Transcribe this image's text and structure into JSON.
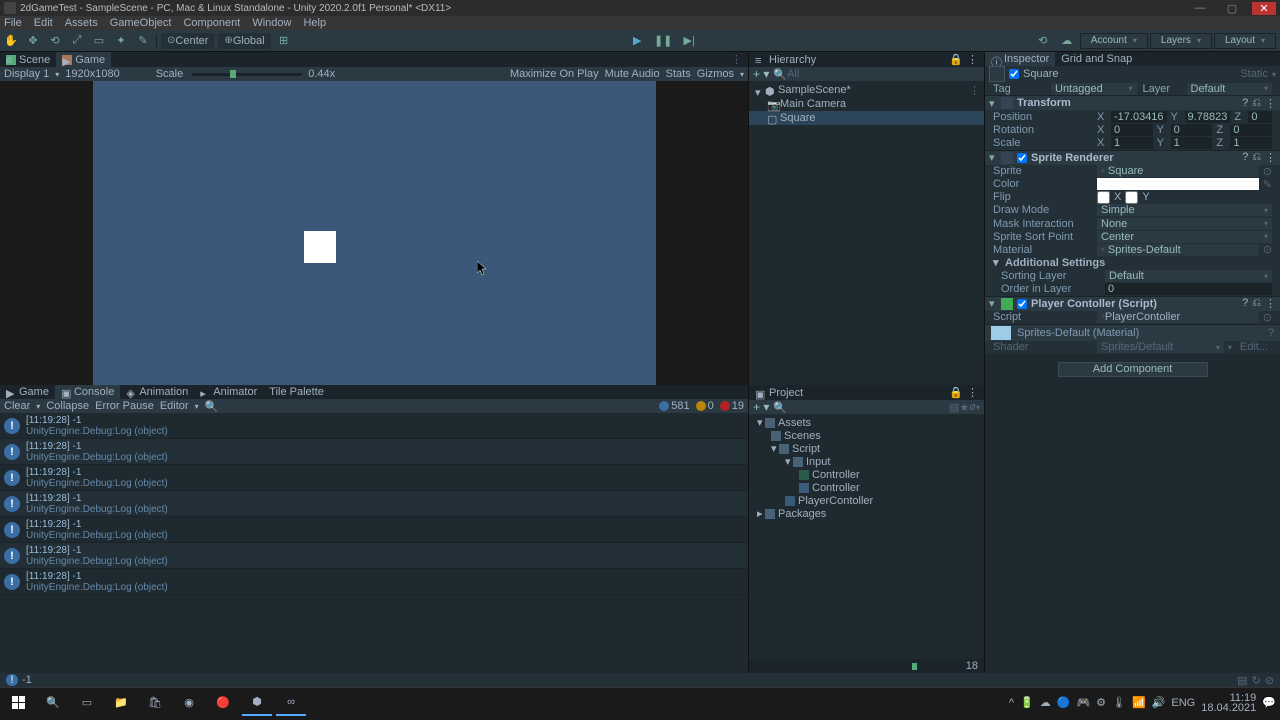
{
  "window": {
    "title": "2dGameTest - SampleScene - PC, Mac & Linux Standalone - Unity 2020.2.0f1 Personal* <DX11>",
    "min": "—",
    "max": "▢",
    "close": "✕"
  },
  "menubar": [
    "File",
    "Edit",
    "Assets",
    "GameObject",
    "Component",
    "Window",
    "Help"
  ],
  "toolbar": {
    "center": "Center",
    "global": "Global",
    "account": "Account",
    "layers": "Layers",
    "layout": "Layout"
  },
  "sceneTabs": {
    "scene": "Scene",
    "game": "Game"
  },
  "gamebar": {
    "display": "Display 1",
    "aspect": "1920x1080",
    "scaleLbl": "Scale",
    "scaleVal": "0.44x",
    "maxplay": "Maximize On Play",
    "mute": "Mute Audio",
    "stats": "Stats",
    "gizmos": "Gizmos"
  },
  "hierarchy": {
    "title": "Hierarchy",
    "all": "All",
    "scene": "SampleScene*",
    "items": [
      "Main Camera",
      "Square"
    ]
  },
  "inspector": {
    "tabInspector": "Inspector",
    "tabGrid": "Grid and Snap",
    "name": "Square",
    "static": "Static",
    "tagLbl": "Tag",
    "tag": "Untagged",
    "layerLbl": "Layer",
    "layer": "Default",
    "transform": {
      "title": "Transform",
      "position": "Position",
      "rotation": "Rotation",
      "scale": "Scale",
      "px": "-17.03416",
      "py": "9.78823",
      "pz": "0",
      "rx": "0",
      "ry": "0",
      "rz": "0",
      "sx": "1",
      "sy": "1",
      "sz": "1"
    },
    "sprite": {
      "title": "Sprite Renderer",
      "spriteLbl": "Sprite",
      "spriteVal": "Square",
      "colorLbl": "Color",
      "flipLbl": "Flip",
      "flipX": "X",
      "flipY": "Y",
      "drawModeLbl": "Draw Mode",
      "drawMode": "Simple",
      "maskLbl": "Mask Interaction",
      "mask": "None",
      "sortPtLbl": "Sprite Sort Point",
      "sortPt": "Center",
      "matLbl": "Material",
      "mat": "Sprites-Default",
      "addl": "Additional Settings",
      "sortLayLbl": "Sorting Layer",
      "sortLay": "Default",
      "orderLbl": "Order in Layer",
      "order": "0"
    },
    "script": {
      "title": "Player Contoller (Script)",
      "scriptLbl": "Script",
      "scriptVal": "PlayerContoller"
    },
    "material": {
      "name": "Sprites-Default (Material)",
      "shaderLbl": "Shader",
      "shader": "Sprites/Default",
      "edit": "Edit..."
    },
    "addComponent": "Add Component"
  },
  "consoleTabs": {
    "game": "Game",
    "console": "Console",
    "animation": "Animation",
    "animator": "Animator",
    "tile": "Tile Palette"
  },
  "consoleTb": {
    "clear": "Clear",
    "collapse": "Collapse",
    "errpause": "Error Pause",
    "editor": "Editor",
    "info": "581",
    "warn": "0",
    "err": "19"
  },
  "log": {
    "l1": "[11:19:28] -1",
    "l2": "UnityEngine.Debug:Log (object)"
  },
  "project": {
    "title": "Project",
    "assets": "Assets",
    "scenes": "Scenes",
    "script": "Script",
    "input": "Input",
    "controller1": "Controller",
    "controller2": "Controller",
    "playerC": "PlayerContoller",
    "packages": "Packages"
  },
  "statusbar": {
    "text": "-1"
  },
  "footerSlider": "18",
  "taskbar": {
    "time": "11:19",
    "date": "18.04.2021",
    "lang": "ENG"
  }
}
